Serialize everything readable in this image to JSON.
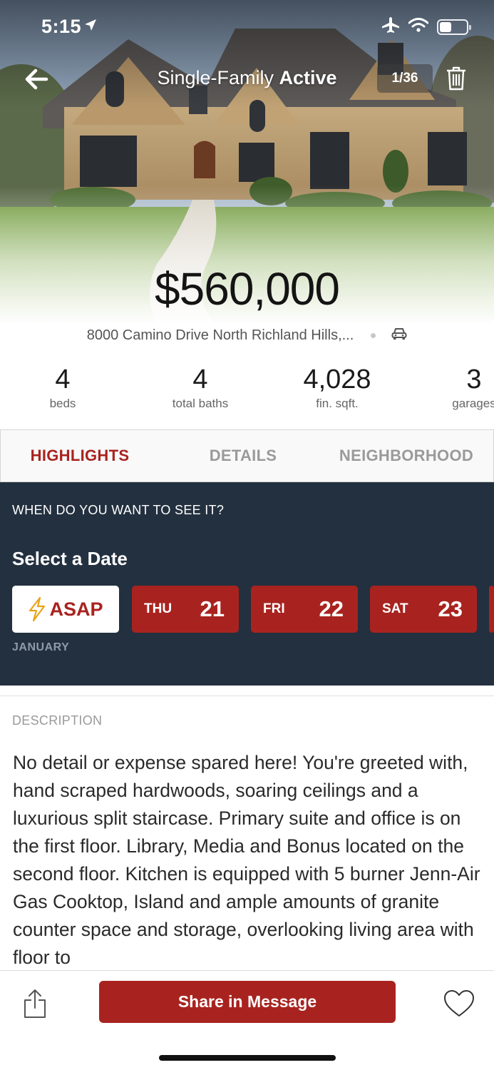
{
  "status_bar": {
    "time": "5:15",
    "icons": [
      "location-arrow-icon",
      "airplane-icon",
      "wifi-icon",
      "battery-icon"
    ],
    "battery_level": 0.45
  },
  "nav": {
    "title_type": "Single-Family",
    "title_status": "Active",
    "photo_counter": "1/36",
    "back_icon": "back-arrow-icon",
    "trash_icon": "trash-icon"
  },
  "listing": {
    "price": "$560,000",
    "address": "8000 Camino Drive North Richland Hills,...",
    "drive_icon": "car-icon",
    "stats": [
      {
        "value": "4",
        "label": "beds"
      },
      {
        "value": "4",
        "label": "total baths"
      },
      {
        "value": "4,028",
        "label": "fin. sqft."
      },
      {
        "value": "3",
        "label": "garages"
      }
    ]
  },
  "tabs": [
    {
      "label": "HIGHLIGHTS",
      "active": true
    },
    {
      "label": "DETAILS",
      "active": false
    },
    {
      "label": "NEIGHBORHOOD",
      "active": false
    }
  ],
  "scheduler": {
    "question": "WHEN DO YOU WANT TO SEE IT?",
    "title": "Select a Date",
    "asap_label": "ASAP",
    "asap_icon": "lightning-icon",
    "dates": [
      {
        "dow": "THU",
        "day": "21"
      },
      {
        "dow": "FRI",
        "day": "22"
      },
      {
        "dow": "SAT",
        "day": "23"
      }
    ],
    "month": "JANUARY"
  },
  "description": {
    "label": "DESCRIPTION",
    "text": "No detail or expense spared here! You're greeted with, hand scraped hardwoods, soaring ceilings and a luxurious split staircase. Primary suite and office is on the first floor. Library, Media and Bonus located on the second floor. Kitchen is equipped with 5 burner Jenn-Air Gas Cooktop, Island and ample amounts of granite counter space and storage, overlooking living area with floor to"
  },
  "bottom_bar": {
    "share_icon": "share-icon",
    "share_button_label": "Share in Message",
    "favorite_icon": "heart-icon"
  },
  "colors": {
    "brand_red": "#a8231f",
    "scheduler_bg": "#23303f",
    "inactive_tab": "#9a9a9a"
  }
}
